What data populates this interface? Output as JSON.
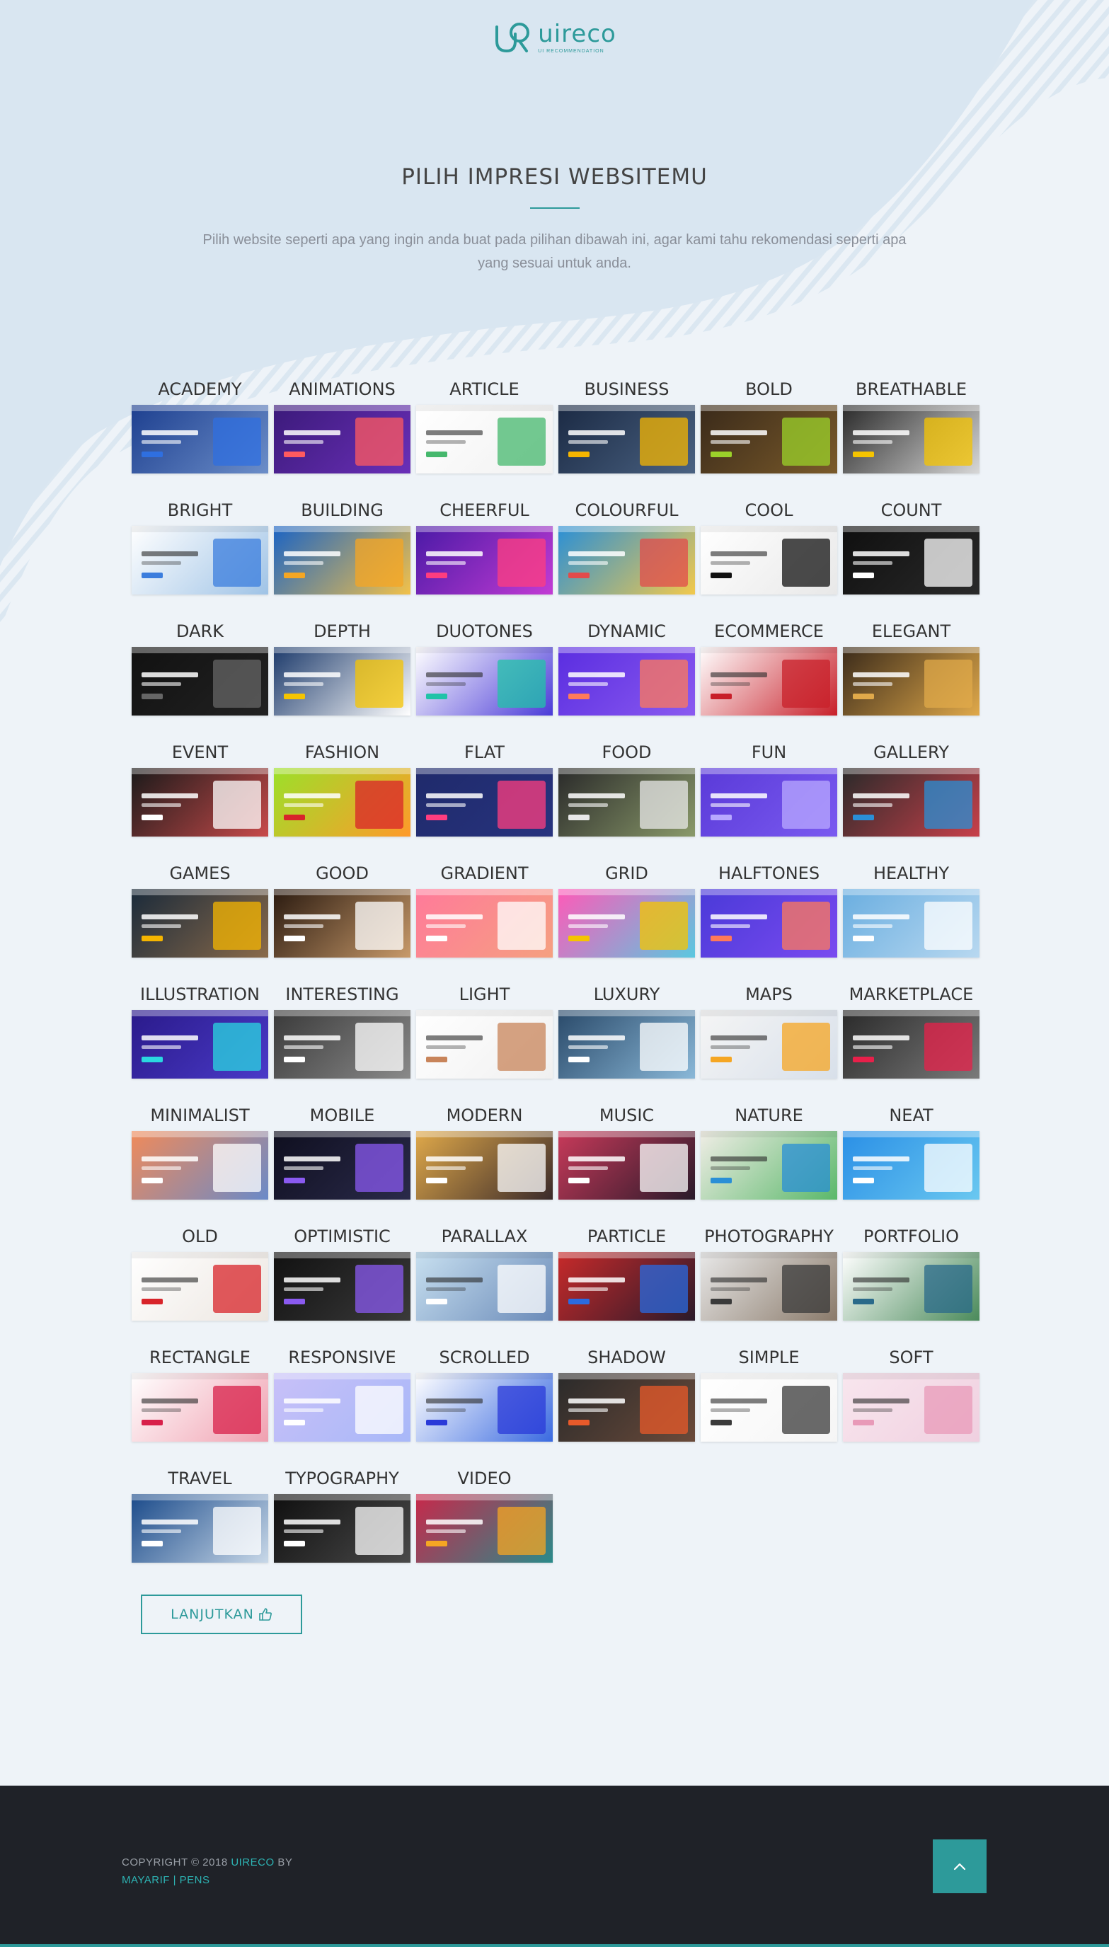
{
  "brand": {
    "name": "uireco",
    "tagline": "UI RECOMMENDATION",
    "accent": "#2d9a9a"
  },
  "hero": {
    "title": "PILIH IMPRESI WEBSITEMU",
    "description": "Pilih website seperti apa yang ingin anda buat pada pilihan dibawah ini, agar kami tahu rekomendasi seperti apa yang sesuai untuk anda."
  },
  "impressions": [
    {
      "label": "ACADEMY",
      "bg": "linear-gradient(135deg,#1d3f8f,#6c8ec9)",
      "accent": "#2f6fe0",
      "tone": "dark"
    },
    {
      "label": "ANIMATIONS",
      "bg": "linear-gradient(135deg,#3b1a7a,#6a2fb8)",
      "accent": "#ff5a5f",
      "tone": "dark"
    },
    {
      "label": "ARTICLE",
      "bg": "linear-gradient(135deg,#ffffff,#f1f1f1)",
      "accent": "#46b86d",
      "tone": "light"
    },
    {
      "label": "BUSINESS",
      "bg": "linear-gradient(135deg,#1b2a44,#4a6282)",
      "accent": "#f5b500",
      "tone": "dark"
    },
    {
      "label": "BOLD",
      "bg": "linear-gradient(135deg,#3a2a1a,#7a5a2a)",
      "accent": "#9bd12a",
      "tone": "dark"
    },
    {
      "label": "BREATHABLE",
      "bg": "linear-gradient(135deg,#2a2a2a,#d8d8d8)",
      "accent": "#f5c400",
      "tone": "dark"
    },
    {
      "label": "BRIGHT",
      "bg": "linear-gradient(135deg,#ffffff,#9fc3e6)",
      "accent": "#3b7ddd",
      "tone": "light"
    },
    {
      "label": "BUILDING",
      "bg": "linear-gradient(135deg,#1a63c4,#f2c14a)",
      "accent": "#f5a623",
      "tone": "dark"
    },
    {
      "label": "CHEERFUL",
      "bg": "linear-gradient(135deg,#4a1aa6,#c23bd4)",
      "accent": "#ff3d7f",
      "tone": "dark"
    },
    {
      "label": "COLOURFUL",
      "bg": "linear-gradient(135deg,#2a8fd6,#f2c94c)",
      "accent": "#e24b4b",
      "tone": "dark"
    },
    {
      "label": "COOL",
      "bg": "linear-gradient(135deg,#ffffff,#e8e8e8)",
      "accent": "#111111",
      "tone": "light"
    },
    {
      "label": "COUNT",
      "bg": "linear-gradient(135deg,#0f0f0f,#2a2a2a)",
      "accent": "#ffffff",
      "tone": "dark"
    },
    {
      "label": "DARK",
      "bg": "linear-gradient(135deg,#111111,#222222)",
      "accent": "#666666",
      "tone": "dark"
    },
    {
      "label": "DEPTH",
      "bg": "linear-gradient(135deg,#1c3a6b,#ffffff)",
      "accent": "#f5c400",
      "tone": "dark"
    },
    {
      "label": "DUOTONES",
      "bg": "linear-gradient(135deg,#ffffff,#4b3bd8)",
      "accent": "#20c3a8",
      "tone": "light"
    },
    {
      "label": "DYNAMIC",
      "bg": "linear-gradient(135deg,#5a2de0,#8a5af0)",
      "accent": "#ff7a59",
      "tone": "dark"
    },
    {
      "label": "ECOMMERCE",
      "bg": "linear-gradient(135deg,#ffffff,#c8202a)",
      "accent": "#c8202a",
      "tone": "light"
    },
    {
      "label": "ELEGANT",
      "bg": "linear-gradient(135deg,#3a2a1a,#e0a94a)",
      "accent": "#e0a94a",
      "tone": "dark"
    },
    {
      "label": "EVENT",
      "bg": "linear-gradient(135deg,#1a1a1a,#c84a4a)",
      "accent": "#ffffff",
      "tone": "dark"
    },
    {
      "label": "FASHION",
      "bg": "linear-gradient(135deg,#9be02a,#ff9a2a)",
      "accent": "#d8242a",
      "tone": "dark"
    },
    {
      "label": "FLAT",
      "bg": "linear-gradient(135deg,#1f2a6b,#27337e)",
      "accent": "#ff3d7f",
      "tone": "dark"
    },
    {
      "label": "FOOD",
      "bg": "linear-gradient(135deg,#2a2a2a,#8a9a6a)",
      "accent": "#e8e8e8",
      "tone": "dark"
    },
    {
      "label": "FUN",
      "bg": "linear-gradient(135deg,#5a3ad8,#7a5af0)",
      "accent": "#b8a8ff",
      "tone": "dark"
    },
    {
      "label": "GALLERY",
      "bg": "linear-gradient(135deg,#2a2a2a,#c8404a)",
      "accent": "#2a8fd6",
      "tone": "dark"
    },
    {
      "label": "GAMES",
      "bg": "linear-gradient(135deg,#1a2a3a,#8a6a4a)",
      "accent": "#f5b500",
      "tone": "dark"
    },
    {
      "label": "GOOD",
      "bg": "linear-gradient(135deg,#2a1a10,#c89a6a)",
      "accent": "#ffffff",
      "tone": "dark"
    },
    {
      "label": "GRADIENT",
      "bg": "linear-gradient(135deg,#ff7a9a,#f5a080)",
      "accent": "#ffffff",
      "tone": "dark"
    },
    {
      "label": "GRID",
      "bg": "linear-gradient(135deg,#ff5ab8,#5ac8e0)",
      "accent": "#f5c400",
      "tone": "dark"
    },
    {
      "label": "HALFTONES",
      "bg": "linear-gradient(135deg,#4a3ad8,#7a4af0)",
      "accent": "#ff7a59",
      "tone": "dark"
    },
    {
      "label": "HEALTHY",
      "bg": "linear-gradient(135deg,#6aaee0,#b8d8f0)",
      "accent": "#ffffff",
      "tone": "dark"
    },
    {
      "label": "ILLUSTRATION",
      "bg": "linear-gradient(135deg,#2a1a8a,#4a3ac8)",
      "accent": "#2ad8e0",
      "tone": "dark"
    },
    {
      "label": "INTERESTING",
      "bg": "linear-gradient(135deg,#3a3a3a,#8a8a8a)",
      "accent": "#ffffff",
      "tone": "dark"
    },
    {
      "label": "LIGHT",
      "bg": "linear-gradient(135deg,#ffffff,#f0f0f0)",
      "accent": "#c8845a",
      "tone": "light"
    },
    {
      "label": "LUXURY",
      "bg": "linear-gradient(135deg,#2a4a6a,#8ab8d8)",
      "accent": "#ffffff",
      "tone": "dark"
    },
    {
      "label": "MAPS",
      "bg": "linear-gradient(135deg,#f5f5f5,#d8e0ea)",
      "accent": "#f5a623",
      "tone": "light"
    },
    {
      "label": "MARKETPLACE",
      "bg": "linear-gradient(135deg,#2a2a2a,#7a7a7a)",
      "accent": "#e8204a",
      "tone": "dark"
    },
    {
      "label": "MINIMALIST",
      "bg": "linear-gradient(135deg,#f08a5a,#6a8ac8)",
      "accent": "#ffffff",
      "tone": "dark"
    },
    {
      "label": "MOBILE",
      "bg": "linear-gradient(135deg,#0f0f1f,#2a2a4a)",
      "accent": "#8a5af0",
      "tone": "dark"
    },
    {
      "label": "MODERN",
      "bg": "linear-gradient(135deg,#e0a94a,#3a2a2a)",
      "accent": "#ffffff",
      "tone": "dark"
    },
    {
      "label": "MUSIC",
      "bg": "linear-gradient(135deg,#c83a5a,#2a1a2a)",
      "accent": "#ffffff",
      "tone": "dark"
    },
    {
      "label": "NATURE",
      "bg": "linear-gradient(135deg,#f0ede6,#5ab86a)",
      "accent": "#2a8fd6",
      "tone": "light"
    },
    {
      "label": "NEAT",
      "bg": "linear-gradient(135deg,#2a8fe6,#6ac8f0)",
      "accent": "#ffffff",
      "tone": "dark"
    },
    {
      "label": "OLD",
      "bg": "linear-gradient(135deg,#ffffff,#ece6e0)",
      "accent": "#d8242a",
      "tone": "light"
    },
    {
      "label": "OPTIMISTIC",
      "bg": "linear-gradient(135deg,#111111,#3a3a3a)",
      "accent": "#8a5af0",
      "tone": "dark"
    },
    {
      "label": "PARALLAX",
      "bg": "linear-gradient(135deg,#c8e0f0,#6a8ab8)",
      "accent": "#ffffff",
      "tone": "light"
    },
    {
      "label": "PARTICLE",
      "bg": "linear-gradient(135deg,#c82a2a,#2a1a2a)",
      "accent": "#2a6ae0",
      "tone": "dark"
    },
    {
      "label": "PHOTOGRAPHY",
      "bg": "linear-gradient(135deg,#e8e8e8,#8a7a6a)",
      "accent": "#3a3a3a",
      "tone": "light"
    },
    {
      "label": "PORTFOLIO",
      "bg": "linear-gradient(135deg,#ffffff,#4a8a5a)",
      "accent": "#2a6a8a",
      "tone": "light"
    },
    {
      "label": "RECTANGLE",
      "bg": "linear-gradient(135deg,#ffffff,#f0a0b0)",
      "accent": "#d8204a",
      "tone": "light"
    },
    {
      "label": "RESPONSIVE",
      "bg": "linear-gradient(135deg,#c8c0f8,#a8b8f8)",
      "accent": "#ffffff",
      "tone": "dark"
    },
    {
      "label": "SCROLLED",
      "bg": "linear-gradient(135deg,#ffffff,#3a6ae0)",
      "accent": "#2a3ad8",
      "tone": "light"
    },
    {
      "label": "SHADOW",
      "bg": "linear-gradient(135deg,#2a2a2a,#6a4a3a)",
      "accent": "#e85a2a",
      "tone": "dark"
    },
    {
      "label": "SIMPLE",
      "bg": "linear-gradient(135deg,#ffffff,#f5f5f5)",
      "accent": "#3a3a3a",
      "tone": "light"
    },
    {
      "label": "SOFT",
      "bg": "linear-gradient(135deg,#f8e6ee,#f0d0e0)",
      "accent": "#e89ab8",
      "tone": "light"
    },
    {
      "label": "TRAVEL",
      "bg": "linear-gradient(135deg,#1a4a8a,#c8d8e8)",
      "accent": "#ffffff",
      "tone": "dark"
    },
    {
      "label": "TYPOGRAPHY",
      "bg": "linear-gradient(135deg,#0f0f0f,#4a4a4a)",
      "accent": "#ffffff",
      "tone": "dark"
    },
    {
      "label": "VIDEO",
      "bg": "linear-gradient(135deg,#c8284a,#2a8a8a)",
      "accent": "#f5a623",
      "tone": "dark"
    }
  ],
  "actions": {
    "continue_label": "LANJUTKAN"
  },
  "footer": {
    "copyright_prefix": "COPYRIGHT © 2018 ",
    "brand_link": "UIRECO",
    "by": " BY",
    "author_link": "MAYARIF | PENS"
  }
}
